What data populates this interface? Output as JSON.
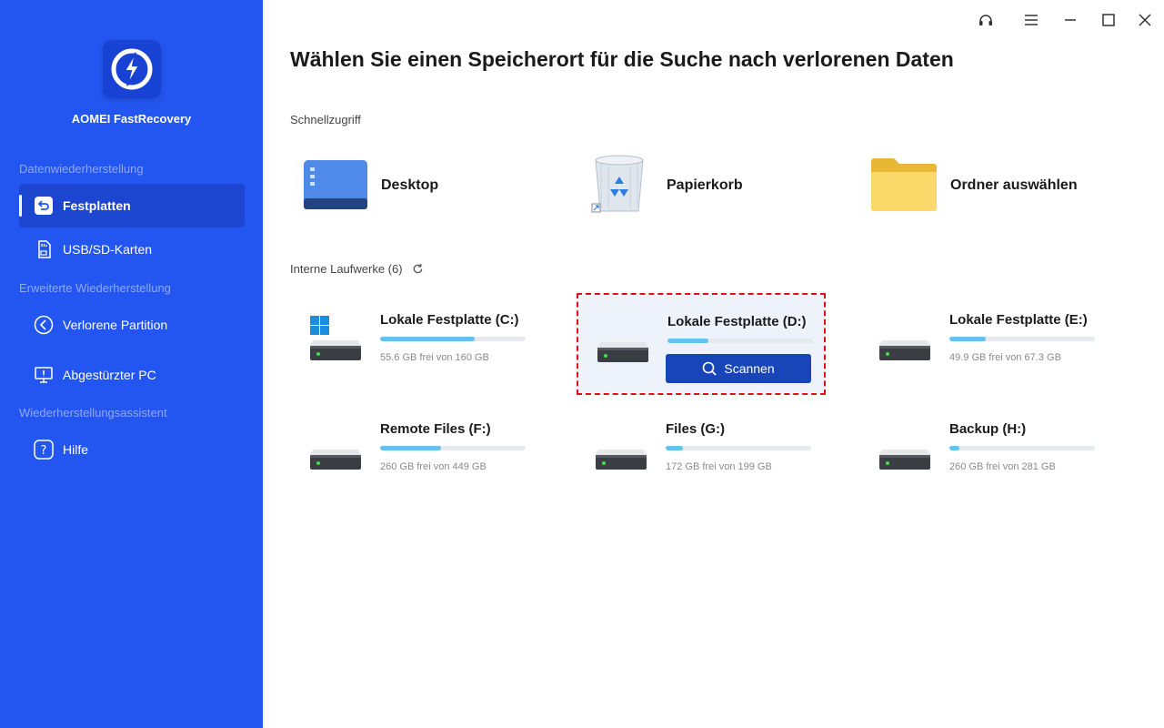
{
  "app": {
    "name": "AOMEI FastRecovery",
    "accent_color": "#2356f0"
  },
  "sidebar": {
    "sections": [
      {
        "label": "Datenwiederherstellung",
        "items": [
          {
            "label": "Festplatten",
            "icon": "restore-icon",
            "active": true
          },
          {
            "label": "USB/SD-Karten",
            "icon": "sd-card-icon",
            "active": false
          }
        ]
      },
      {
        "label": "Erweiterte Wiederherstellung",
        "items": [
          {
            "label": "Verlorene Partition",
            "icon": "partition-icon",
            "active": false
          },
          {
            "label": "Abgestürzter PC",
            "icon": "monitor-icon",
            "active": false
          }
        ]
      },
      {
        "label": "Wiederherstellungsassistent",
        "items": [
          {
            "label": "Hilfe",
            "icon": "help-icon",
            "active": false
          }
        ]
      }
    ]
  },
  "window_controls": [
    "support-icon",
    "menu-icon",
    "minimize-icon",
    "maximize-icon",
    "close-icon"
  ],
  "main": {
    "title": "Wählen Sie einen Speicherort für die Suche nach verlorenen Daten",
    "quick_access": {
      "label": "Schnellzugriff",
      "items": [
        {
          "label": "Desktop",
          "icon": "desktop-icon"
        },
        {
          "label": "Papierkorb",
          "icon": "recycle-bin-icon"
        },
        {
          "label": "Ordner auswählen",
          "icon": "folder-icon"
        }
      ]
    },
    "drives": {
      "label": "Interne Laufwerke (6)",
      "scan_label": "Scannen",
      "items": [
        {
          "name": "Lokale Festplatte (C:)",
          "size": "55.6 GB frei von 160 GB",
          "used_fraction": 0.65,
          "system": true,
          "selected": false
        },
        {
          "name": "Lokale Festplatte (D:)",
          "size": "",
          "used_fraction": 0.28,
          "system": false,
          "selected": true
        },
        {
          "name": "Lokale Festplatte (E:)",
          "size": "49.9 GB frei von 67.3 GB",
          "used_fraction": 0.25,
          "system": false,
          "selected": false
        },
        {
          "name": "Remote Files (F:)",
          "size": "260 GB frei von 449 GB",
          "used_fraction": 0.42,
          "system": false,
          "selected": false
        },
        {
          "name": "Files (G:)",
          "size": "172 GB frei von 199 GB",
          "used_fraction": 0.12,
          "system": false,
          "selected": false
        },
        {
          "name": "Backup (H:)",
          "size": "260 GB frei von 281 GB",
          "used_fraction": 0.07,
          "system": false,
          "selected": false
        }
      ]
    }
  }
}
